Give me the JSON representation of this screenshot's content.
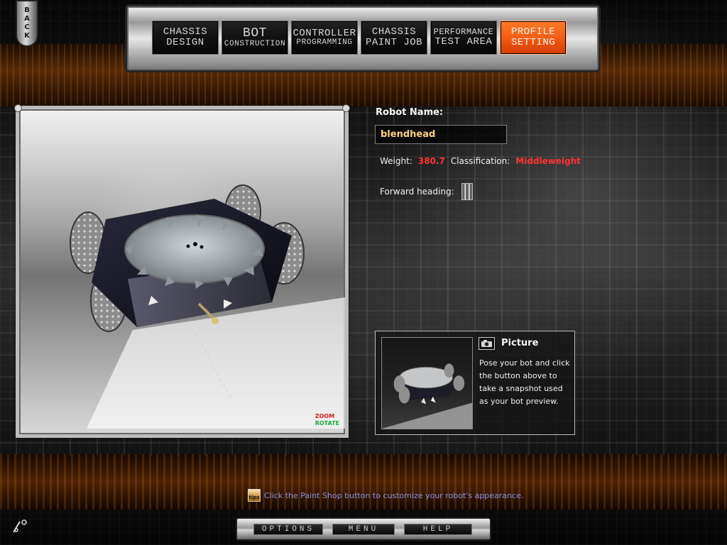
{
  "navigation": {
    "back_label": "BACK",
    "tabs": [
      {
        "line1": "CHASSIS",
        "line2": "DESIGN",
        "active": false
      },
      {
        "line1": "BOT",
        "line2": "CONSTRUCTION",
        "active": false
      },
      {
        "line1": "CONTROLLER",
        "line2": "PROGRAMMING",
        "active": false
      },
      {
        "line1": "CHASSIS",
        "line2": "PAINT JOB",
        "active": false
      },
      {
        "line1": "PERFORMANCE",
        "line2": "TEST AREA",
        "active": false
      },
      {
        "line1": "PROFILE",
        "line2": "SETTING",
        "active": true
      }
    ]
  },
  "viewport": {
    "zoom_label": "ZOOM",
    "rotate_label": "ROTATE"
  },
  "profile": {
    "robot_name_label": "Robot Name:",
    "robot_name_value": "blendhead",
    "weight_label": "Weight:",
    "weight_value": "380.7",
    "classification_label": "Classification:",
    "classification_value": "Middleweight",
    "forward_heading_label": "Forward heading:"
  },
  "picture_panel": {
    "title": "Picture",
    "description": "Pose your bot and click the button above to take a snapshot used as your bot preview."
  },
  "tip": {
    "icon_text": "tips",
    "text": "Click the Paint Shop button to customize your robot's appearance."
  },
  "footer": {
    "options_label": "OPTIONS",
    "menu_label": "MENU",
    "help_label": "HELP"
  },
  "colors": {
    "active_tab": "#f05a12",
    "weight_value": "#ff3434",
    "classification_value": "#ff3434",
    "robot_name": "#ffd27c",
    "tip_text": "#8e8ee8"
  },
  "icons": {
    "camera": "camera-icon",
    "tip": "tip-icon",
    "corner": "status-icon"
  }
}
